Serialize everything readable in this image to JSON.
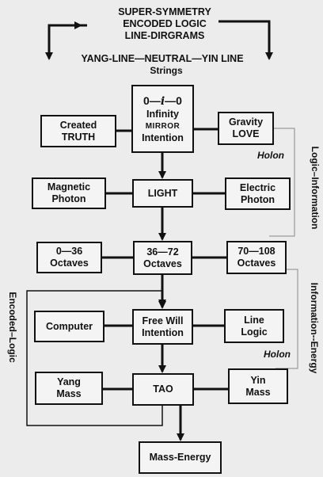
{
  "header": {
    "title_lines": [
      "SUPER-SYMMETRY",
      "ENCODED LOGIC",
      "LINE-DIRGRAMS"
    ],
    "strings_line": "YANG-LINE—NEUTRAL—YIN LINE",
    "strings_sub": "Strings"
  },
  "top": {
    "zero_left": "0",
    "italic_i": "i",
    "zero_right": "0",
    "infinity": "Infinity",
    "mirror": "MIRROR",
    "intention": "Intention"
  },
  "row1": {
    "left": [
      "Created",
      "TRUTH"
    ],
    "right": [
      "Gravity",
      "LOVE"
    ]
  },
  "row2": {
    "left": [
      "Magnetic",
      "Photon"
    ],
    "center": "LIGHT",
    "right": [
      "Electric",
      "Photon"
    ]
  },
  "row3": {
    "left": [
      "0—36",
      "Octaves"
    ],
    "center": [
      "36—72",
      "Octaves"
    ],
    "right": [
      "70—108",
      "Octaves"
    ]
  },
  "row4": {
    "left": "Computer",
    "center": [
      "Free Will",
      "Intention"
    ],
    "right": [
      "Line",
      "Logic"
    ]
  },
  "row5": {
    "left": [
      "Yang",
      "Mass"
    ],
    "center": "TAO",
    "right": [
      "Yin",
      "Mass"
    ]
  },
  "bottom": "Mass-Energy",
  "labels": {
    "holon_top": "Holon",
    "holon_bottom": "Holon",
    "logic_information": "Logic–Information",
    "information_energy": "Information--Energy",
    "encoded_logic": "Encoded–Logic"
  }
}
